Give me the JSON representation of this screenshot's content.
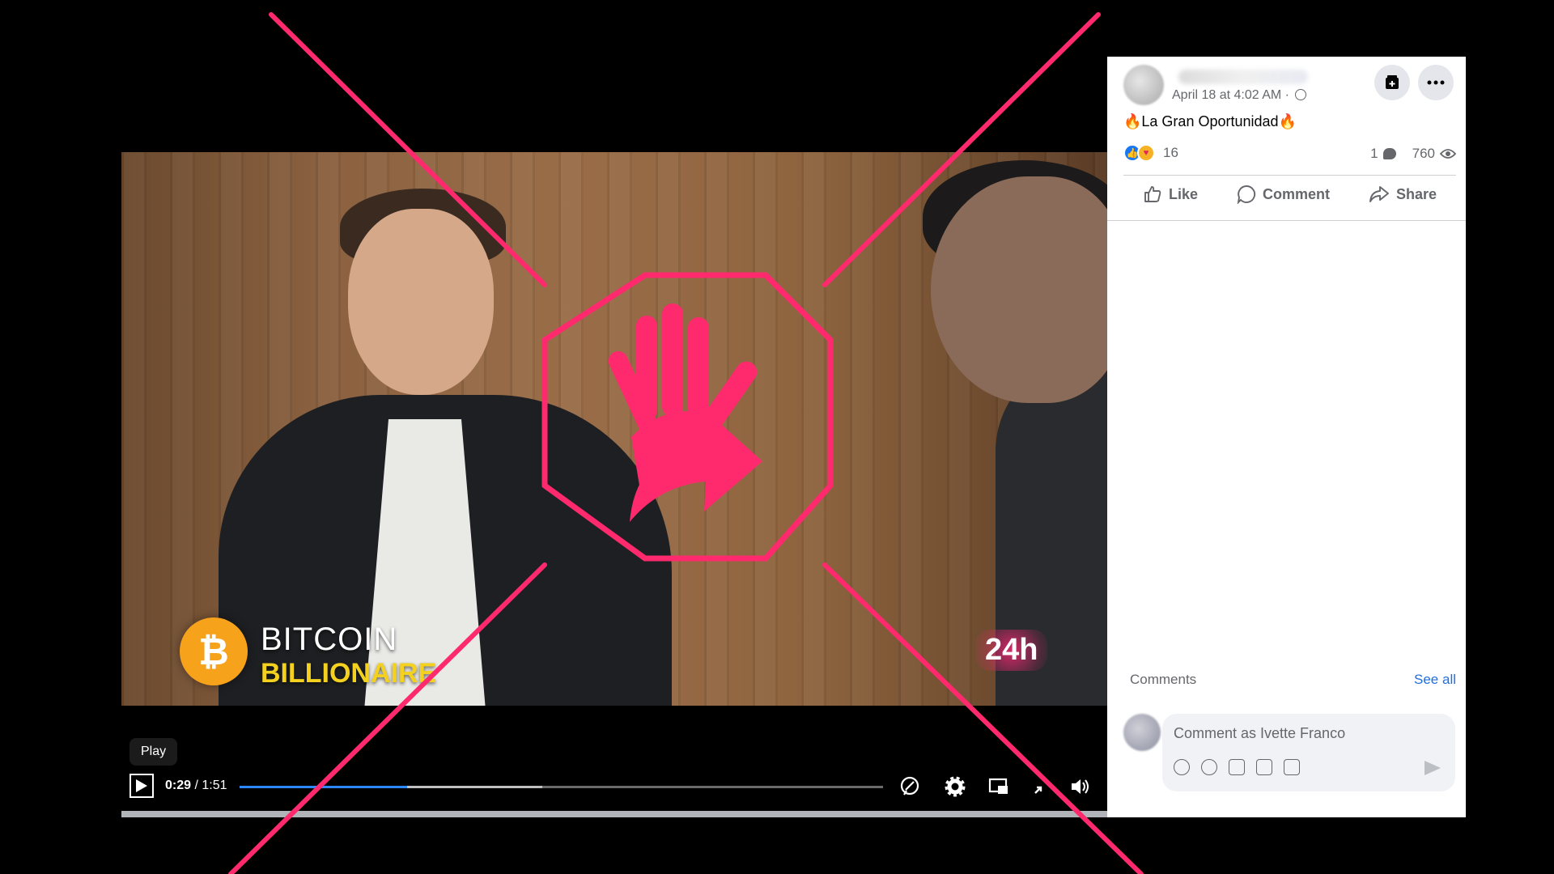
{
  "video": {
    "overlay_brand_line1": "BITCOIN",
    "overlay_brand_line2": "BILLIONAIRE",
    "overlay_brand_symbol": "₿",
    "channel_logo": "24h",
    "tooltip": "Play",
    "time_current": "0:29",
    "time_separator": " / ",
    "time_total": "1:51",
    "progress_played_fraction": 0.26,
    "progress_buffered_fraction": 0.47
  },
  "post": {
    "timestamp": "April 18 at 4:02 AM ·",
    "text": "🔥La Gran Oportunidad🔥",
    "reaction_count": "16",
    "comment_count": "1",
    "view_count": "760",
    "actions": {
      "like": "Like",
      "comment": "Comment",
      "share": "Share"
    },
    "comments_label": "Comments",
    "see_all": "See all",
    "comment_placeholder": "Comment as Ivette Franco"
  },
  "icons": [
    "save-icon",
    "more-icon",
    "like-reaction-icon",
    "care-reaction-icon",
    "comment-bubble-icon",
    "eye-icon",
    "thumbs-up-icon",
    "comment-icon",
    "share-icon",
    "captions-icon",
    "settings-icon",
    "pip-icon",
    "exit-fullscreen-icon",
    "volume-icon",
    "play-icon",
    "sticker-icon",
    "emoji-icon",
    "camera-icon",
    "gif-icon",
    "avatar-sticker-icon",
    "send-icon",
    "stop-hand-icon"
  ],
  "colors": {
    "overlay_accent": "#ff2a6d",
    "progress": "#2d88ff",
    "link": "#216fdb"
  }
}
